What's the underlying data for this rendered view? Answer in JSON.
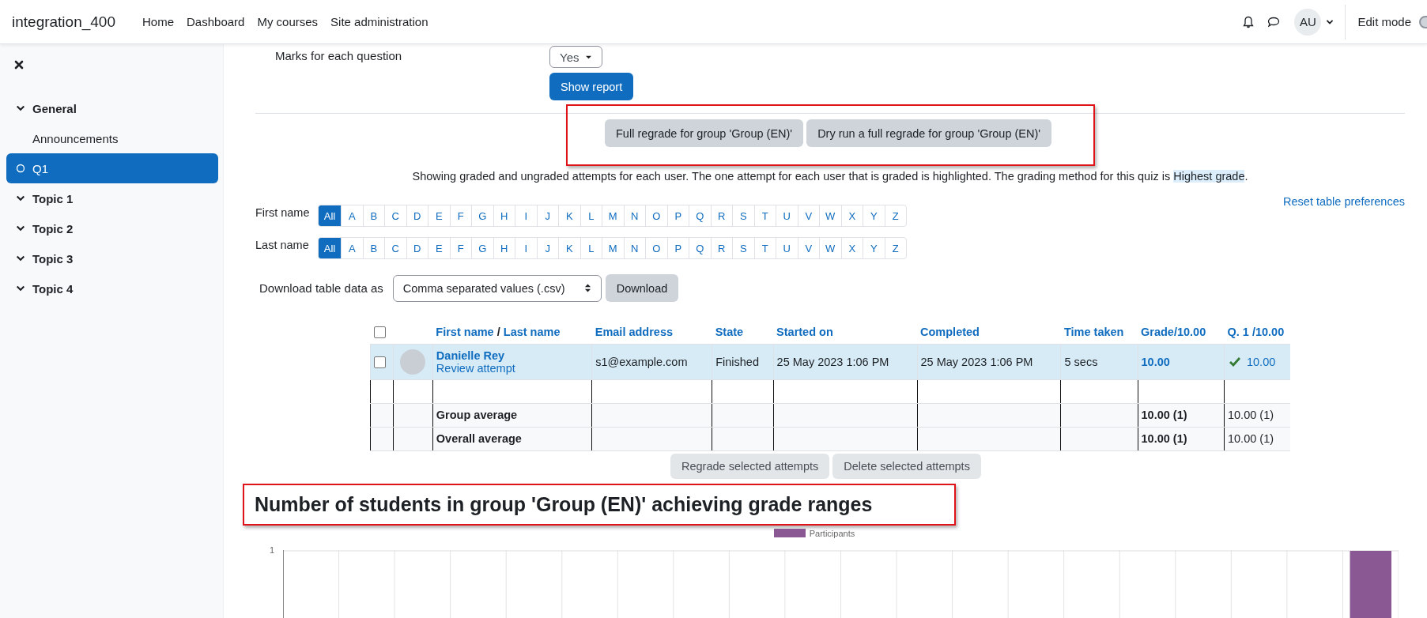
{
  "navbar": {
    "site_name": "integration_400",
    "links": [
      "Home",
      "Dashboard",
      "My courses",
      "Site administration"
    ],
    "avatar_initials": "AU",
    "edit_mode_label": "Edit mode",
    "edit_mode_on": false
  },
  "sidebar": {
    "items": [
      {
        "kind": "section",
        "label": "General",
        "expanded": true,
        "selected": false
      },
      {
        "kind": "link",
        "label": "Announcements",
        "selected": false
      },
      {
        "kind": "activity",
        "label": "Q1",
        "selected": true
      },
      {
        "kind": "section",
        "label": "Topic 1",
        "expanded": true,
        "selected": false
      },
      {
        "kind": "section",
        "label": "Topic 2",
        "expanded": true,
        "selected": false
      },
      {
        "kind": "section",
        "label": "Topic 3",
        "expanded": true,
        "selected": false
      },
      {
        "kind": "section",
        "label": "Topic 4",
        "expanded": true,
        "selected": false
      }
    ]
  },
  "report": {
    "marks_label": "Marks for each question",
    "marks_value": "Yes",
    "show_report": "Show report",
    "regrade_buttons": [
      "Full regrade for group 'Group (EN)'",
      "Dry run a full regrade for group 'Group (EN)'"
    ],
    "summary": {
      "before": "Showing graded and ungraded attempts for each user. The one attempt for each user that is graded is highlighted. The grading method for this quiz is ",
      "highlight": "Highest grade",
      "after": "."
    },
    "reset_link": "Reset table preferences",
    "filters": [
      {
        "label": "First name",
        "letters": [
          {
            "text": "All",
            "selected": true
          },
          {
            "text": "A",
            "selected": false
          },
          {
            "text": "B",
            "selected": false
          },
          {
            "text": "C",
            "selected": false
          },
          {
            "text": "D",
            "selected": false
          },
          {
            "text": "E",
            "selected": false
          },
          {
            "text": "F",
            "selected": false
          },
          {
            "text": "G",
            "selected": false
          },
          {
            "text": "H",
            "selected": false
          },
          {
            "text": "I",
            "selected": false
          },
          {
            "text": "J",
            "selected": false
          },
          {
            "text": "K",
            "selected": false
          },
          {
            "text": "L",
            "selected": false
          },
          {
            "text": "M",
            "selected": false
          },
          {
            "text": "N",
            "selected": false
          },
          {
            "text": "O",
            "selected": false
          },
          {
            "text": "P",
            "selected": false
          },
          {
            "text": "Q",
            "selected": false
          },
          {
            "text": "R",
            "selected": false
          },
          {
            "text": "S",
            "selected": false
          },
          {
            "text": "T",
            "selected": false
          },
          {
            "text": "U",
            "selected": false
          },
          {
            "text": "V",
            "selected": false
          },
          {
            "text": "W",
            "selected": false
          },
          {
            "text": "X",
            "selected": false
          },
          {
            "text": "Y",
            "selected": false
          },
          {
            "text": "Z",
            "selected": false
          }
        ]
      },
      {
        "label": "Last name",
        "letters": [
          {
            "text": "All",
            "selected": true
          },
          {
            "text": "A",
            "selected": false
          },
          {
            "text": "B",
            "selected": false
          },
          {
            "text": "C",
            "selected": false
          },
          {
            "text": "D",
            "selected": false
          },
          {
            "text": "E",
            "selected": false
          },
          {
            "text": "F",
            "selected": false
          },
          {
            "text": "G",
            "selected": false
          },
          {
            "text": "H",
            "selected": false
          },
          {
            "text": "I",
            "selected": false
          },
          {
            "text": "J",
            "selected": false
          },
          {
            "text": "K",
            "selected": false
          },
          {
            "text": "L",
            "selected": false
          },
          {
            "text": "M",
            "selected": false
          },
          {
            "text": "N",
            "selected": false
          },
          {
            "text": "O",
            "selected": false
          },
          {
            "text": "P",
            "selected": false
          },
          {
            "text": "Q",
            "selected": false
          },
          {
            "text": "R",
            "selected": false
          },
          {
            "text": "S",
            "selected": false
          },
          {
            "text": "T",
            "selected": false
          },
          {
            "text": "U",
            "selected": false
          },
          {
            "text": "V",
            "selected": false
          },
          {
            "text": "W",
            "selected": false
          },
          {
            "text": "X",
            "selected": false
          },
          {
            "text": "Y",
            "selected": false
          },
          {
            "text": "Z",
            "selected": false
          }
        ]
      }
    ],
    "download": {
      "label": "Download table data as",
      "format": "Comma separated values (.csv)",
      "button": "Download"
    },
    "table": {
      "select_all_checked": false,
      "columns": [
        {
          "kind": "check"
        },
        {
          "kind": "picture"
        },
        {
          "kind": "name",
          "parts": [
            "First name",
            "Last name"
          ],
          "separator": "/"
        },
        {
          "kind": "text",
          "label": "Email address"
        },
        {
          "kind": "text",
          "label": "State"
        },
        {
          "kind": "text",
          "label": "Started on"
        },
        {
          "kind": "text",
          "label": "Completed"
        },
        {
          "kind": "text",
          "label": "Time taken"
        },
        {
          "kind": "text",
          "label": "Grade/10.00"
        },
        {
          "kind": "text",
          "label": "Q. 1 /10.00"
        }
      ],
      "rows": [
        {
          "kind": "attempt",
          "highlighted": true,
          "checked": false,
          "name": "Danielle Rey",
          "review": "Review attempt",
          "email": "s1@example.com",
          "state": "Finished",
          "started": "25 May 2023 1:06 PM",
          "completed": "25 May 2023 1:06 PM",
          "time": "5 secs",
          "grade": "10.00",
          "q1": "10.00",
          "q1_correct": true
        },
        {
          "kind": "spacer"
        },
        {
          "kind": "average",
          "label": "Group average",
          "grade": "10.00 (1)",
          "q1": "10.00 (1)"
        },
        {
          "kind": "average",
          "label": "Overall average",
          "grade": "10.00 (1)",
          "q1": "10.00 (1)"
        }
      ]
    },
    "selected_actions": [
      {
        "label": "Regrade selected attempts",
        "disabled": true
      },
      {
        "label": "Delete selected attempts",
        "disabled": true
      }
    ],
    "chart_title": "Number of students in group 'Group (EN)' achieving grade ranges",
    "chart": {
      "legend": "Participants",
      "y_tick": "1"
    }
  }
}
